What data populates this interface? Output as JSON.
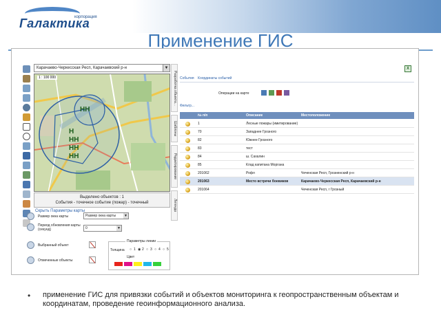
{
  "header": {
    "logo_text": "Галактика",
    "logo_small": "корпорация",
    "title": "Применение ГИС"
  },
  "map_panel": {
    "region_select": "Карачаево-Черкесская Респ, Карачаевский р-н",
    "scale": "1 : 100 000",
    "info_line1": "Выделено объектов : 1",
    "info_line2": "События - точечное событие (пожар) - точечный",
    "settings_link": "Скрыть Параметры карты",
    "symbols": [
      "НН",
      "Н",
      "НН",
      "НН",
      "НН"
    ],
    "vertical_tabs": [
      "Разработка объекта...",
      "Шаблоны",
      "Редактирование",
      "Легенда"
    ]
  },
  "settings": {
    "map_size_label": "Размер окна карты",
    "map_size_value": "Размер окна карты",
    "refresh_label": "Период обновления карты (секунд)",
    "refresh_value": "0",
    "selected_label": "Выбранный объект",
    "marked_label": "Отмеченные объекты",
    "params_title": "Параметры линии",
    "thickness_label": "Толщина",
    "thickness_options": [
      "1",
      "2",
      "3",
      "4",
      "5"
    ],
    "color_label": "Цвет",
    "swatch_colors": [
      "#e8241c",
      "#e0108a",
      "#ffef1a",
      "#22b8e8",
      "#36d13b"
    ]
  },
  "events_panel": {
    "tab_events": "События",
    "tab_coords": "Координаты событий",
    "operations_label": "Операции на карте",
    "find_link": "Фильтр...",
    "columns": [
      "№ п/п",
      "Описание",
      "Местоположение"
    ],
    "rows": [
      {
        "num": "1",
        "desc": "Лесные пожары (имитирование)",
        "loc": "",
        "selected": false
      },
      {
        "num": "70",
        "desc": "Западнее Грозного",
        "loc": "",
        "selected": false
      },
      {
        "num": "82",
        "desc": "Южнее Грозного",
        "loc": "",
        "selected": false
      },
      {
        "num": "83",
        "desc": "тест",
        "loc": "",
        "selected": false
      },
      {
        "num": "84",
        "desc": "ш. Сахалин",
        "loc": "",
        "selected": false
      },
      {
        "num": "85",
        "desc": "Клад капитана Моргана",
        "loc": "",
        "selected": false
      },
      {
        "num": "201062",
        "desc": "Рофл",
        "loc": "Чеченская Респ, Грозненский р-н",
        "selected": false
      },
      {
        "num": "201063",
        "desc": "Место встречи боевиков",
        "loc": "Карачаево-Черкесская Респ, Карачаевский р-н",
        "selected": true
      },
      {
        "num": "201064",
        "desc": "",
        "loc": "Чеченская Респ, г Грозный",
        "selected": false
      }
    ]
  },
  "caption": "применение ГИС для привязки событий и объектов мониторинга к геопространственным объектам и координатам, проведение геоинформационного анализа."
}
